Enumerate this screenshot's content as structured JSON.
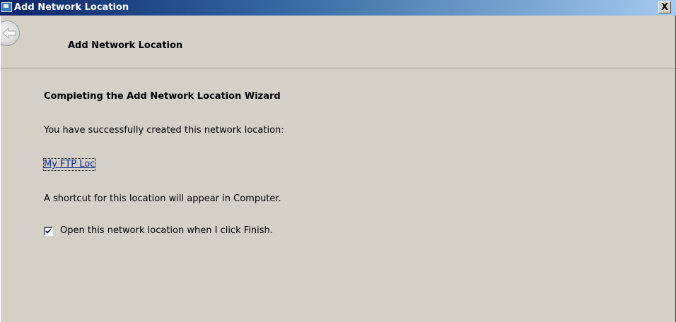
{
  "window": {
    "title": "Add Network Location",
    "close_label": "X"
  },
  "header": {
    "wizard_title": "Add Network Location"
  },
  "content": {
    "heading": "Completing the Add Network Location Wizard",
    "success_text": "You have successfully created this network location:",
    "location_link": "My FTP Loc",
    "shortcut_text": "A shortcut for this location will appear in Computer.",
    "open_checkbox": {
      "label": "Open this network location when I click Finish.",
      "checked": true
    }
  },
  "icons": {
    "window_icon": "network-location-icon",
    "back": "back-arrow-icon",
    "check": "checkmark-icon"
  }
}
